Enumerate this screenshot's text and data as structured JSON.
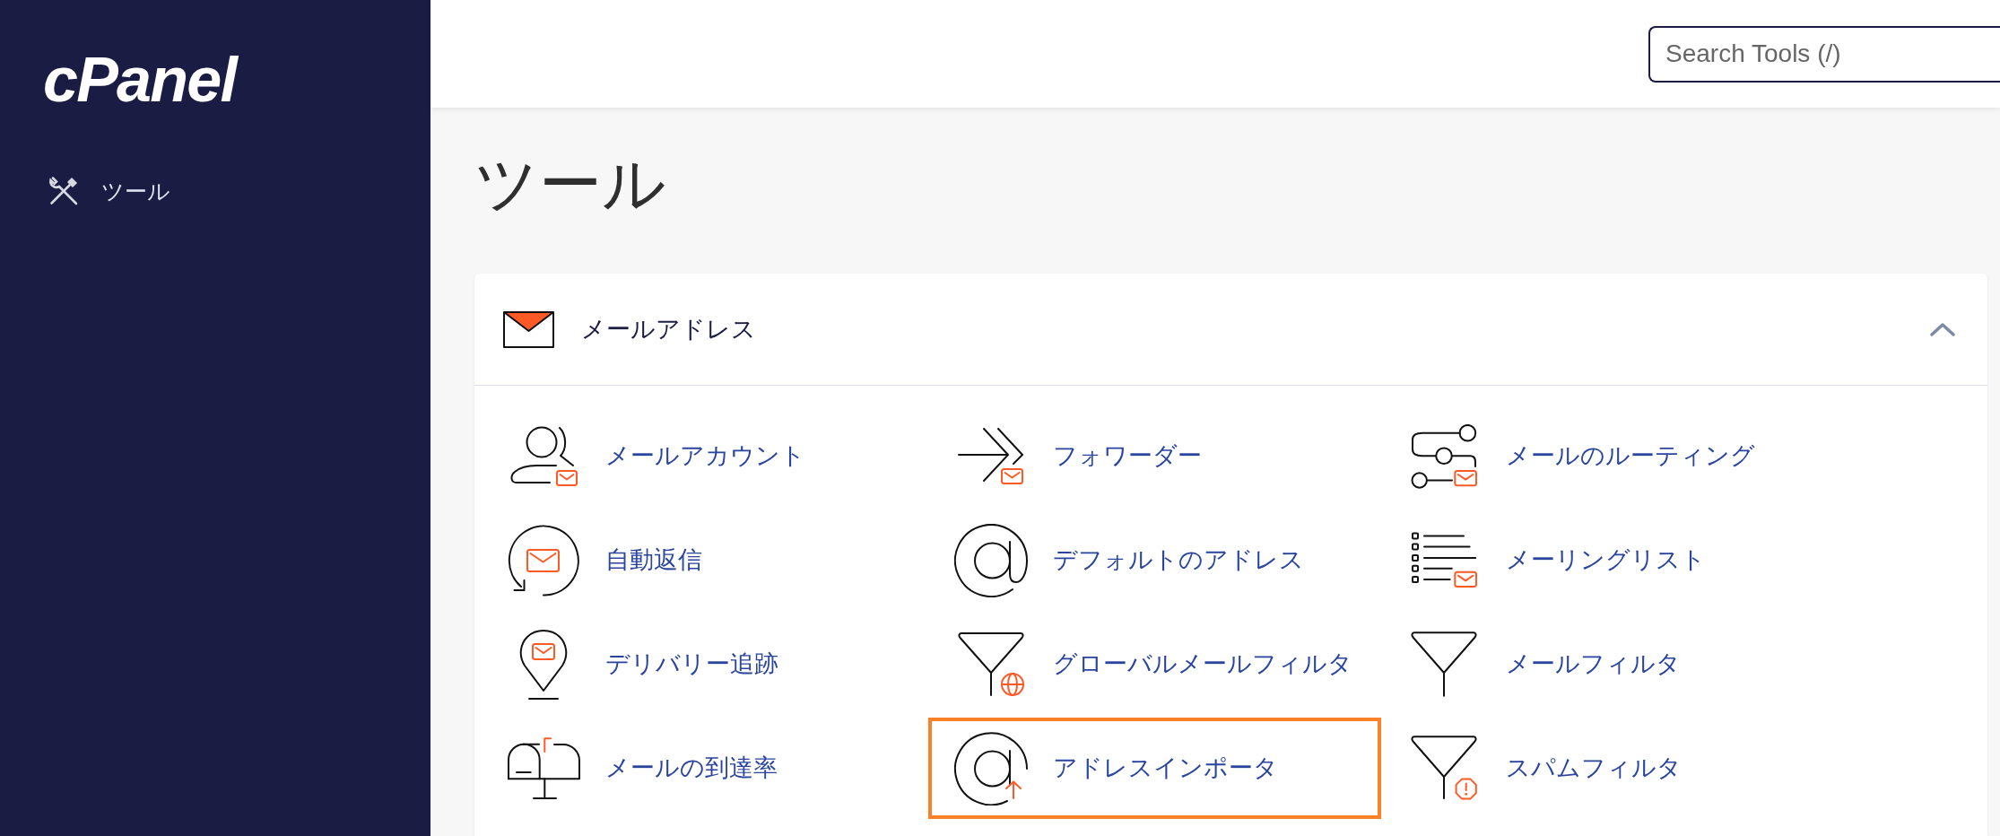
{
  "sidebar": {
    "logo": "cPanel",
    "items": [
      {
        "label": "ツール"
      }
    ]
  },
  "search": {
    "placeholder": "Search Tools (/)"
  },
  "page_title": "ツール",
  "sections": [
    {
      "title": "メールアドレス",
      "expanded": true,
      "items": [
        {
          "label": "メールアカウント",
          "kind": "account",
          "highlighted": false
        },
        {
          "label": "フォワーダー",
          "kind": "forwarder",
          "highlighted": false
        },
        {
          "label": "メールのルーティング",
          "kind": "routing",
          "highlighted": false
        },
        {
          "label": "自動返信",
          "kind": "autoresponder",
          "highlighted": false
        },
        {
          "label": "デフォルトのアドレス",
          "kind": "defaultaddress",
          "highlighted": false
        },
        {
          "label": "メーリングリスト",
          "kind": "mailinglist",
          "highlighted": false
        },
        {
          "label": "デリバリー追跡",
          "kind": "tracking",
          "highlighted": false
        },
        {
          "label": "グローバルメールフィルタ",
          "kind": "globalfilter",
          "highlighted": false
        },
        {
          "label": "メールフィルタ",
          "kind": "filter",
          "highlighted": false
        },
        {
          "label": "メールの到達率",
          "kind": "deliverability",
          "highlighted": false
        },
        {
          "label": "アドレスインポータ",
          "kind": "importer",
          "highlighted": true
        },
        {
          "label": "スパムフィルタ",
          "kind": "spamfilter",
          "highlighted": false
        }
      ]
    }
  ]
}
